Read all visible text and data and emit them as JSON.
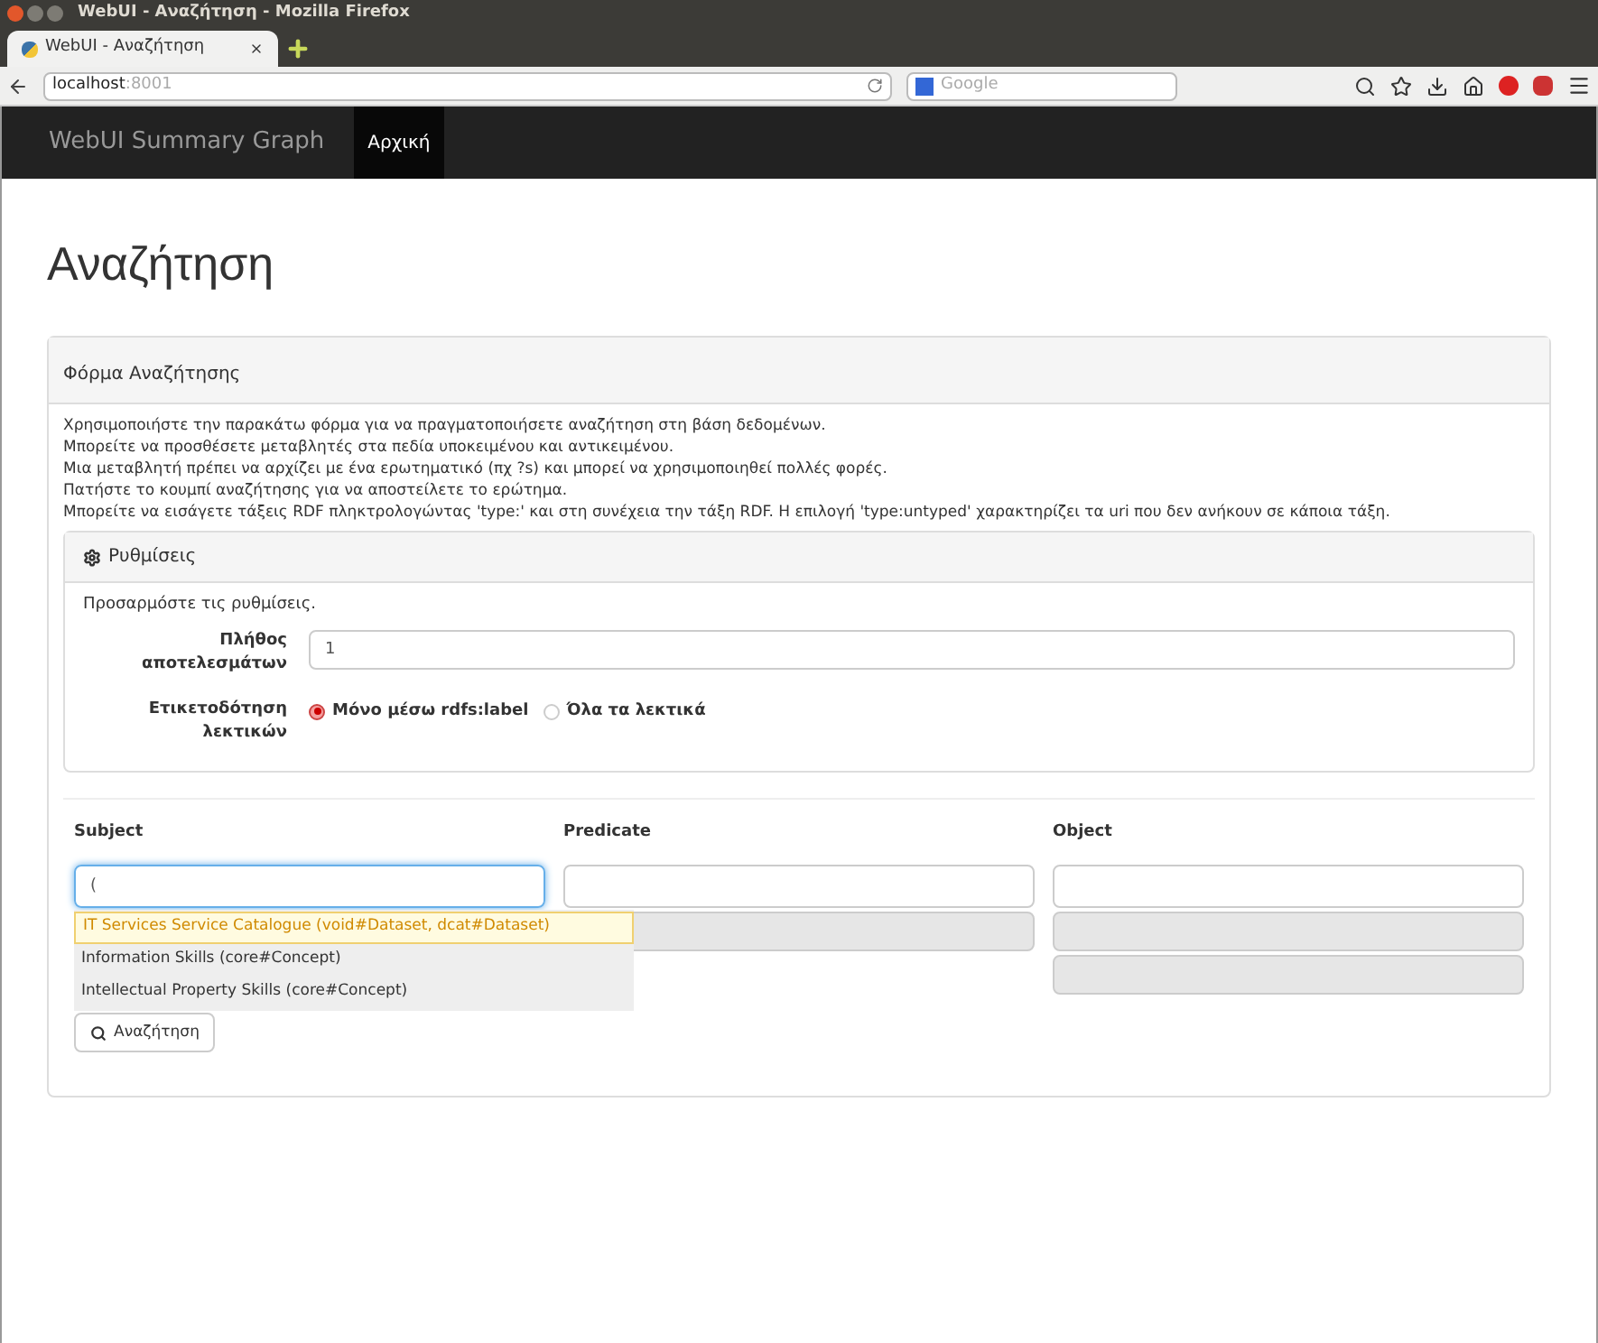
{
  "window": {
    "title": "WebUI - Αναζήτηση - Mozilla Firefox"
  },
  "tabs": [
    {
      "label": "WebUI - Αναζήτηση",
      "selected": true
    }
  ],
  "address_bar": {
    "host": "localhost",
    "port": ":8001"
  },
  "search_bar": {
    "placeholder": "Google"
  },
  "navbar": {
    "brand": "WebUI Summary Graph",
    "items": [
      {
        "label": "Αρχική",
        "selected": true
      }
    ]
  },
  "page_title": "Αναζήτηση",
  "form_panel": {
    "title": "Φόρμα Αναζήτησης",
    "instructions": [
      "Χρησιμοποιήστε την παρακάτω φόρμα για να πραγματοποιήσετε αναζήτηση στη βάση δεδομένων.",
      "Μπορείτε να προσθέσετε μεταβλητές στα πεδία υποκειμένου και αντικειμένου.",
      "Μια μεταβλητή πρέπει να αρχίζει με ένα ερωτηματικό (πχ ?s) και μπορεί να χρησιμοποιηθεί πολλές φορές.",
      "Πατήστε το κουμπί αναζήτησης για να αποστείλετε το ερώτημα.",
      "Μπορείτε να εισάγετε τάξεις RDF πληκτρολογώντας 'type:' και στη συνέχεια την τάξη RDF. Η επιλογή 'type:untyped' χαρακτηρίζει τα uri που δεν ανήκουν σε κάποια τάξη."
    ]
  },
  "settings": {
    "title": "Ρυθμίσεις",
    "intro": "Προσαρμόστε τις ρυθμίσεις.",
    "results_label": "Πλήθος αποτελεσμάτων",
    "results_value": "1",
    "labeling_label": "Ετικετοδότηση λεκτικών",
    "labeling_options": [
      {
        "label": "Μόνο μέσω rdfs:label",
        "selected": true
      },
      {
        "label": "Όλα τα λεκτικά",
        "selected": false
      }
    ]
  },
  "query": {
    "columns": [
      "Subject",
      "Predicate",
      "Object"
    ],
    "subject_value": "(",
    "suggestions": [
      {
        "label": "IT Services Service Catalogue (void#Dataset, dcat#Dataset)",
        "selected": true
      },
      {
        "label": "Information Skills (core#Concept)",
        "selected": false
      },
      {
        "label": "Intellectual Property Skills (core#Concept)",
        "selected": false
      }
    ],
    "search_button": "Αναζήτηση"
  }
}
